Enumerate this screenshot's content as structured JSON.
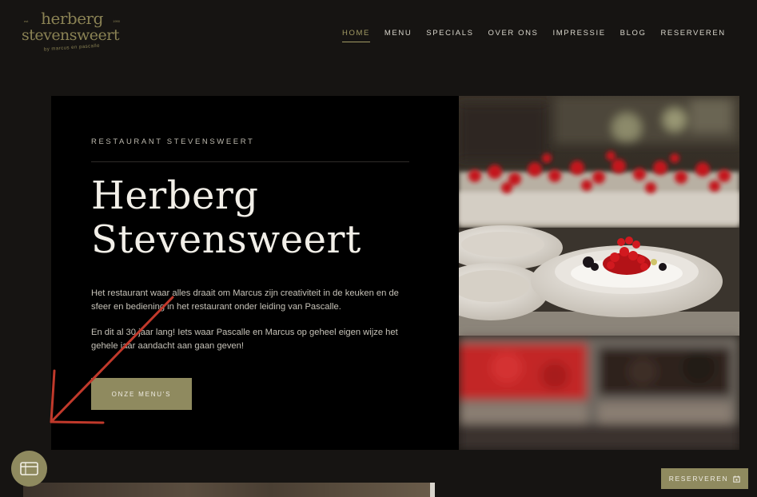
{
  "logo": {
    "line1": "herberg",
    "line2": "stevensweert",
    "tagline": "by marcus en pascalle",
    "est": "est",
    "year": "1990"
  },
  "nav": {
    "items": [
      {
        "label": "HOME",
        "active": true
      },
      {
        "label": "MENU"
      },
      {
        "label": "SPECIALS"
      },
      {
        "label": "OVER ONS"
      },
      {
        "label": "IMPRESSIE"
      },
      {
        "label": "BLOG"
      },
      {
        "label": "RESERVEREN"
      }
    ]
  },
  "hero": {
    "kicker": "RESTAURANT STEVENSWEERT",
    "title_line1": "Herberg",
    "title_line2": "Stevensweert",
    "paragraph1": "Het restaurant waar alles draait om Marcus zijn creativiteit in de keuken en de sfeer en bediening in het restaurant onder leiding van Pascalle.",
    "paragraph2": "En dit al 30 jaar lang! Iets waar Pascalle en Marcus op geheel eigen wijze het gehele jaar aandacht aan gaan geven!",
    "cta_label": "ONZE MENU'S"
  },
  "floating": {
    "reserve_label": "RESERVEREN",
    "fab_icon": "ticket-icon",
    "reserve_icon": "calendar-icon"
  },
  "colors": {
    "background": "#161412",
    "accent": "#8f8a5f",
    "panel": "#000000",
    "annotation": "#c0392b"
  }
}
